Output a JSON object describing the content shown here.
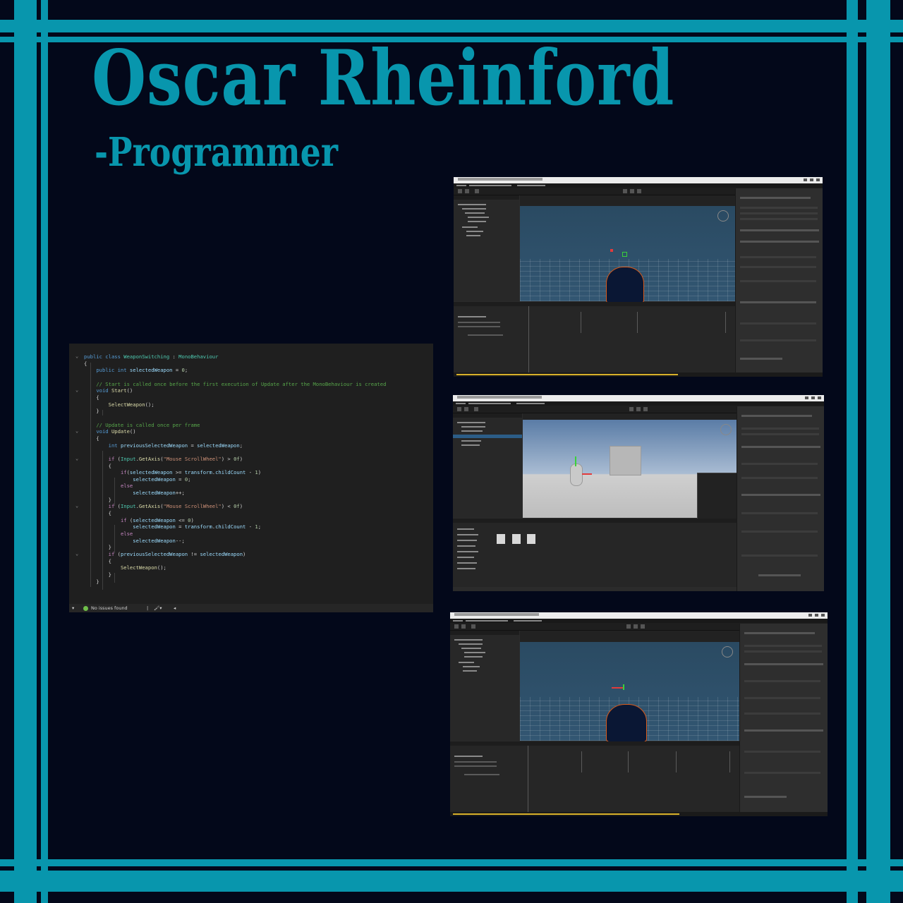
{
  "colors": {
    "accent": "#0896ad",
    "background": "#03081a",
    "code_panel": "#1f1f1f",
    "editor_sky": "#2f4f66",
    "editor_sky_light": "#aebfd3",
    "character_orange": "#d85a1a",
    "character_navy": "#0a1734"
  },
  "header": {
    "name": "Oscar Rheinford",
    "role": "-Programmer"
  },
  "code": {
    "language": "csharp",
    "status": "No issues found"
  },
  "screenshots": [
    {
      "label": "unity-editor-animation",
      "icon": "unity-editor-screenshot"
    },
    {
      "label": "unity-editor-scene",
      "icon": "unity-editor-screenshot"
    },
    {
      "label": "unity-editor-animation-2",
      "icon": "unity-editor-screenshot"
    }
  ]
}
